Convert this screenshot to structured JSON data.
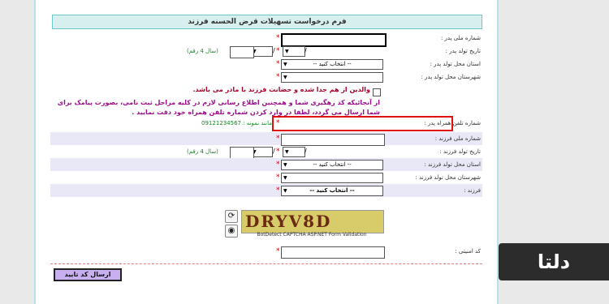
{
  "form": {
    "title": "فرم درخواست تسهیلات قرض الحسنه فرزند",
    "required_mark": "*",
    "fields": {
      "father_national_id": "شماره ملی پدر :",
      "father_birth_date": "تاریخ تولد پدر :",
      "father_birth_province": "استان محل تولد پدر :",
      "father_birth_city": "شهرستان محل تولد پدر :",
      "father_mobile": "شماره تلفن همراه پدر :",
      "child_national_id": "شماره ملی فرزند :",
      "child_birth_date": "تاریخ تولد فرزند :",
      "child_birth_province": "استان محل تولد فرزند :",
      "child_birth_city": "شهرستان محل تولد فرزند :",
      "child": "فرزند :",
      "security_code": "کد امنیتی :"
    },
    "year_hint": "(سال 4 رقم)",
    "select_placeholder": "-- انتخاب کنید --",
    "slash": "/",
    "parents_separated_checkbox": "والدین از هم جدا شده و حضانت فرزند با مادر می باشد.",
    "notice": "از آنجائیکه کد رهگیری شما و همچنین اطلاع رسانی لازم در کلیه مراحل ثبت نامی، بصورت پیامک برای شما ارسال می گردد، لطفا در وارد کردن شماره تلفن همراه خود دقت نمایید .",
    "mobile_example": "مانند نمونه : 09121234567",
    "captcha_text": "DRYV8D",
    "captcha_caption": "BotDetect CAPTCHA ASP.NET Form Validation",
    "submit_label": "ارسال کد تایید"
  },
  "brand": {
    "logo_text": "دلتا"
  },
  "icons": {
    "captcha_reload": "reload-icon",
    "captcha_sound": "speaker-icon"
  },
  "colors": {
    "header_bg": "#d7f0ef",
    "alt_row": "#e8e8f6",
    "highlight": "#e01010",
    "notice_red": "#a8002c",
    "notice_purple": "#9c0c8c",
    "hint_green": "#118822",
    "submit_bg": "#c8b0f0"
  }
}
